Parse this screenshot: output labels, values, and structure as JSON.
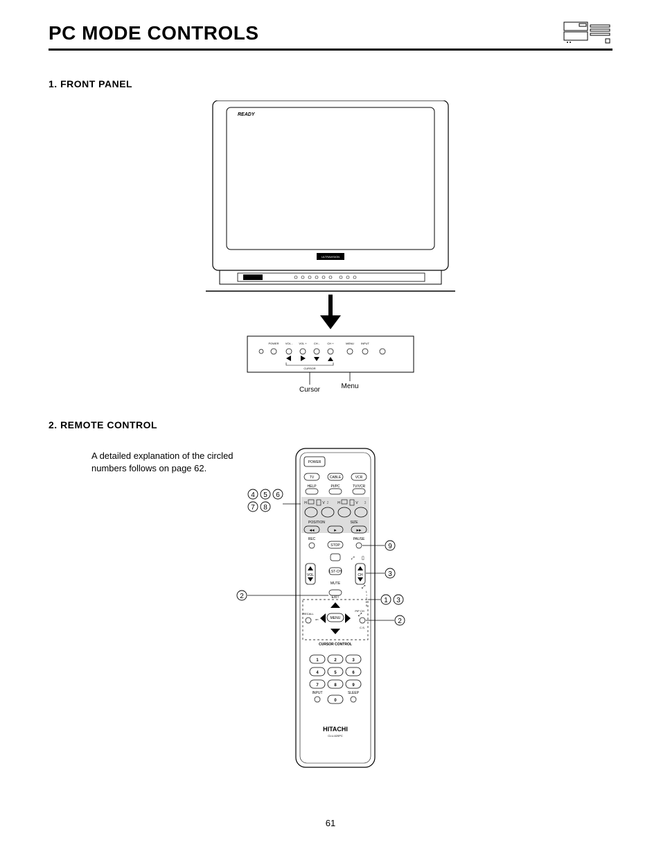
{
  "page_title": "PC MODE CONTROLS",
  "page_number": "61",
  "sections": {
    "front_panel": {
      "heading": "1. FRONT PANEL"
    },
    "remote": {
      "heading": "2. REMOTE CONTROL"
    }
  },
  "intro_text": "A detailed explanation of the circled numbers follows on page 62.",
  "tv_labels": {
    "ready": "READY",
    "brand_bar": "ULTRAVISION",
    "brand_small": "HITACHI",
    "panel_power": "POWER",
    "panel_vol_minus": "VOL ‑",
    "panel_vol_plus": "VOL +",
    "panel_ch_minus": "CH ‑",
    "panel_ch_plus": "CH +",
    "panel_menu": "MENU",
    "panel_input": "INPUT",
    "panel_cursor_bracket": "CURSOR",
    "callout_menu": "Menu",
    "callout_cursor": "Cursor"
  },
  "remote_labels": {
    "power": "POWER",
    "tv": "TV",
    "cable": "CABLE",
    "vcr": "VCR",
    "help": "HELP",
    "pipc": "PI/PC",
    "tvvcr": "TV/VCR",
    "h": "H",
    "v": "V",
    "position": "POSITION",
    "size": "SIZE",
    "rec": "REC",
    "stop": "STOP",
    "pause": "PAUSE",
    "vol": "VOL",
    "lstch": "LST-CH",
    "ch": "CH",
    "mute": "MUTE",
    "lites": "L I T E S",
    "exit": "EXIT",
    "recall": "RECALL",
    "on": "on",
    "menu": "MENU",
    "pip_ch": "PIP CH",
    "cs": "C.S.",
    "cursor_control": "CURSOR CONTROL",
    "keys": [
      "1",
      "2",
      "3",
      "4",
      "5",
      "6",
      "7",
      "8",
      "9",
      "0"
    ],
    "input": "INPUT",
    "sleep": "SLEEP",
    "brand": "HITACHI",
    "model": "CLU-620PC"
  },
  "callout_left_cluster": {
    "items": [
      "4",
      "5",
      "6",
      "7",
      "8"
    ]
  },
  "callouts_other": {
    "right_pause": "9",
    "right_ch": "3",
    "left_mute": "2",
    "right_lites_a": "1",
    "right_lites_b": "3",
    "right_cs": "2"
  }
}
